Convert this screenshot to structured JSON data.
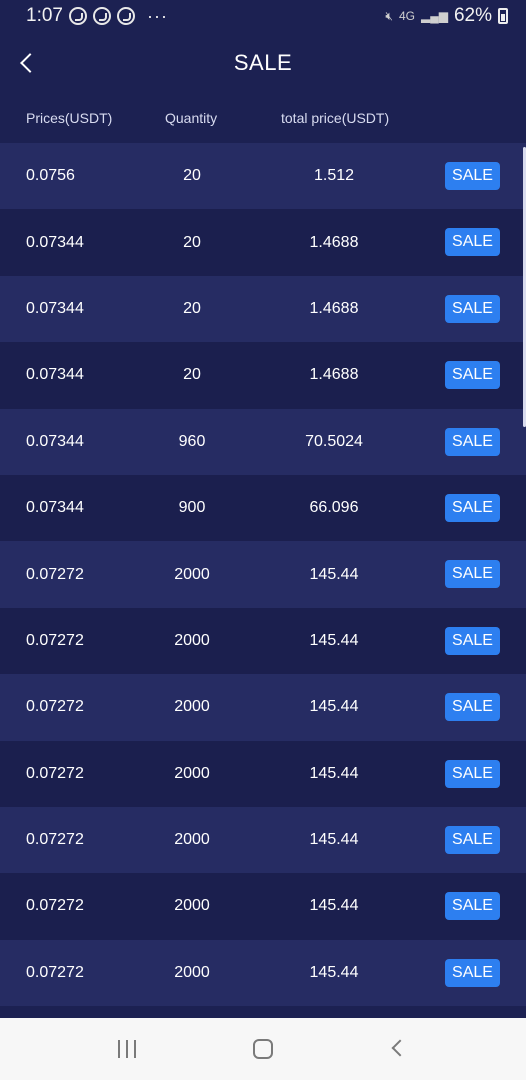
{
  "status": {
    "time": "1:07",
    "more": "···",
    "network": "4G",
    "battery": "62%"
  },
  "header": {
    "title": "SALE"
  },
  "columns": {
    "price": "Prices(USDT)",
    "quantity": "Quantity",
    "total": "total price(USDT)"
  },
  "rows": [
    {
      "price": "0.0756",
      "qty": "20",
      "total": "1.512",
      "action": "SALE"
    },
    {
      "price": "0.07344",
      "qty": "20",
      "total": "1.4688",
      "action": "SALE"
    },
    {
      "price": "0.07344",
      "qty": "20",
      "total": "1.4688",
      "action": "SALE"
    },
    {
      "price": "0.07344",
      "qty": "20",
      "total": "1.4688",
      "action": "SALE"
    },
    {
      "price": "0.07344",
      "qty": "960",
      "total": "70.5024",
      "action": "SALE"
    },
    {
      "price": "0.07344",
      "qty": "900",
      "total": "66.096",
      "action": "SALE"
    },
    {
      "price": "0.07272",
      "qty": "2000",
      "total": "145.44",
      "action": "SALE"
    },
    {
      "price": "0.07272",
      "qty": "2000",
      "total": "145.44",
      "action": "SALE"
    },
    {
      "price": "0.07272",
      "qty": "2000",
      "total": "145.44",
      "action": "SALE"
    },
    {
      "price": "0.07272",
      "qty": "2000",
      "total": "145.44",
      "action": "SALE"
    },
    {
      "price": "0.07272",
      "qty": "2000",
      "total": "145.44",
      "action": "SALE"
    },
    {
      "price": "0.07272",
      "qty": "2000",
      "total": "145.44",
      "action": "SALE"
    },
    {
      "price": "0.07272",
      "qty": "2000",
      "total": "145.44",
      "action": "SALE"
    }
  ],
  "colors": {
    "background": "#1c2152",
    "row_alt": "#262c63",
    "accent": "#2d7ff0"
  },
  "icons": [
    "viber-icon",
    "mute-icon",
    "wifi-icon",
    "signal-icon",
    "battery-icon",
    "back-arrow-icon",
    "recents-icon",
    "home-icon",
    "nav-back-icon"
  ]
}
